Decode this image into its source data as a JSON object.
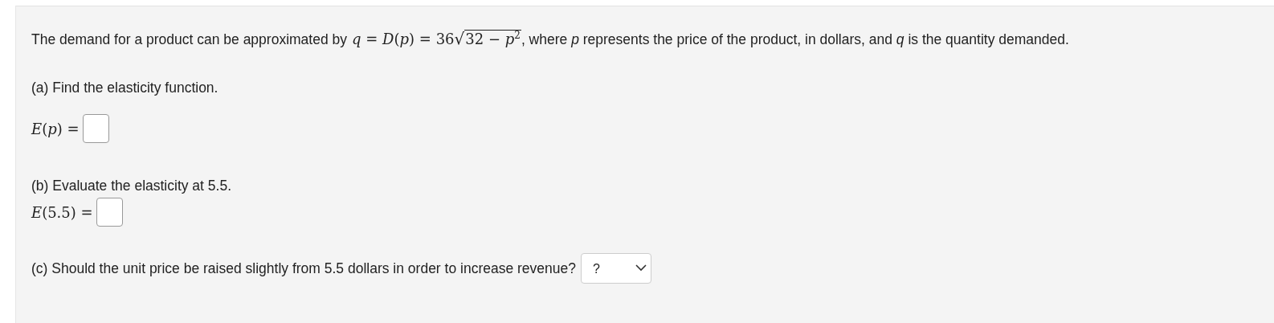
{
  "question": {
    "intro_before": "The demand for a product can be approximated by",
    "formula": {
      "lead": "*q* = *D*(*p*) = 36",
      "radical": "√",
      "radicand": "32 − *p*$^{2}$"
    },
    "intro_after": ", where *p* represents the price of the product, in dollars, and *q* is the quantity demanded."
  },
  "parts": [
    {
      "kind": "answer",
      "prompt": "(a) Find the elasticity function.",
      "label": "*E*(*p*) ="
    },
    {
      "kind": "answer",
      "prompt": "(b) Evaluate the elasticity at 5.5.",
      "label": "*E*(5.5) ="
    },
    {
      "kind": "choice",
      "prompt": "(c) Should the unit price be raised slightly from 5.5 dollars in order to increase revenue?",
      "value": "?"
    }
  ]
}
